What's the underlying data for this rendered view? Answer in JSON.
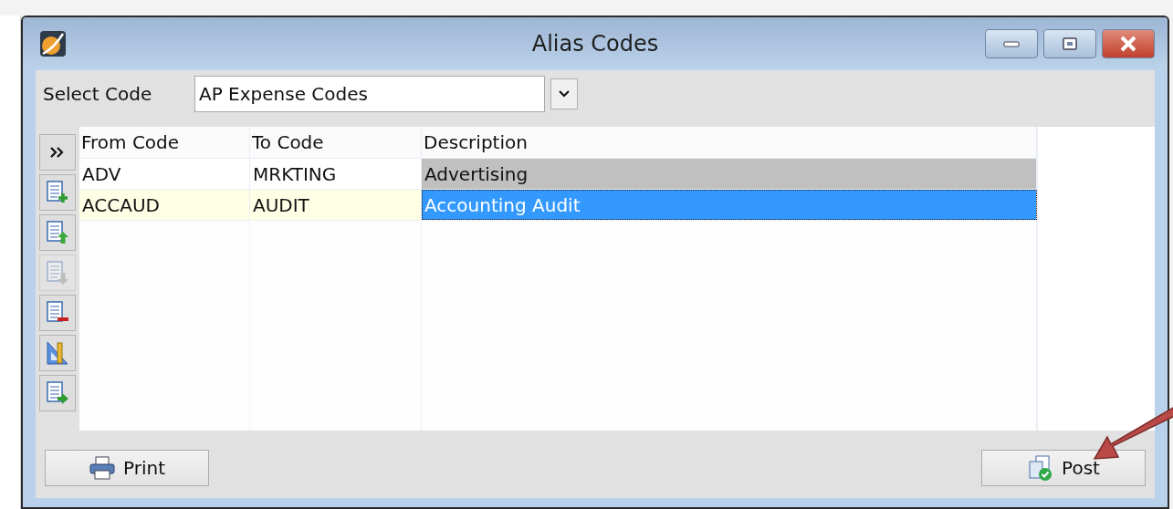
{
  "window": {
    "title": "Alias Codes"
  },
  "select_code": {
    "label": "Select Code",
    "value": "AP Expense Codes"
  },
  "toolbar": [
    {
      "kind": "expand",
      "disabled": false
    },
    {
      "kind": "add",
      "disabled": false
    },
    {
      "kind": "move_up",
      "disabled": false
    },
    {
      "kind": "move_down",
      "disabled": true
    },
    {
      "kind": "remove",
      "disabled": false
    },
    {
      "kind": "design",
      "disabled": false
    },
    {
      "kind": "export",
      "disabled": false
    }
  ],
  "table": {
    "columns": [
      "From Code",
      "To Code",
      "Description"
    ],
    "rows": [
      {
        "cells": [
          "ADV",
          "MRKTING",
          "Advertising"
        ],
        "selected": false,
        "marked": true
      },
      {
        "cells": [
          "ACCAUD",
          "AUDIT",
          "Accounting Audit"
        ],
        "selected": true,
        "marked": false
      }
    ]
  },
  "buttons": [
    {
      "kind": "print",
      "label": "Print"
    },
    {
      "kind": "post",
      "label": "Post"
    }
  ],
  "annotation": {
    "kind": "arrow"
  }
}
